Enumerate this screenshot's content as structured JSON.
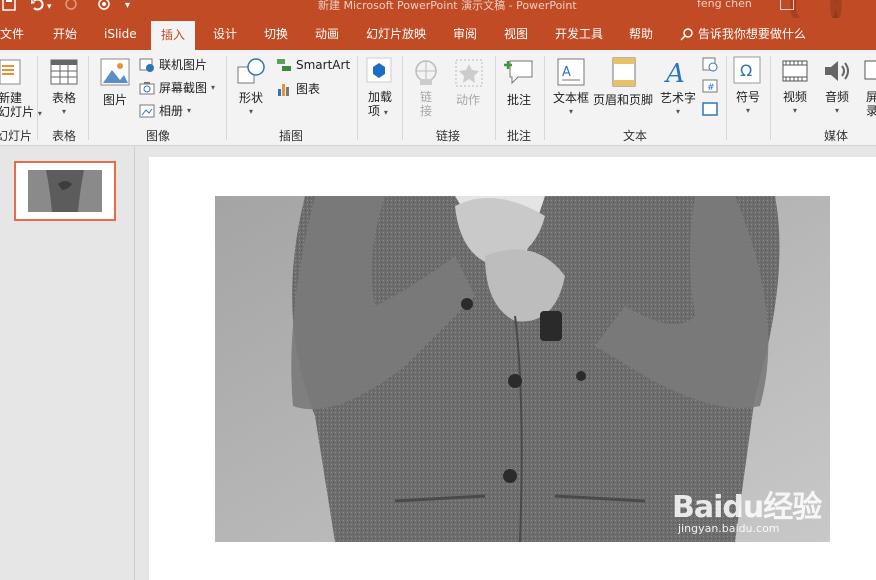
{
  "app": {
    "title": "新建 Microsoft PowerPoint 演示文稿  -  PowerPoint",
    "user": "feng chen",
    "colors": {
      "accent": "#c04b24",
      "ribbon_bg": "#f3f3f3",
      "thumb_border": "#e46c47"
    }
  },
  "qat": {
    "save_icon": "save-icon",
    "undo_icon": "undo-icon",
    "redo_icon": "redo-icon",
    "present_icon": "present-icon",
    "more_icon": "customize-icon"
  },
  "tabs": [
    {
      "label": "文件"
    },
    {
      "label": "开始"
    },
    {
      "label": "iSlide"
    },
    {
      "label": "插入"
    },
    {
      "label": "设计"
    },
    {
      "label": "切换"
    },
    {
      "label": "动画"
    },
    {
      "label": "幻灯片放映"
    },
    {
      "label": "审阅"
    },
    {
      "label": "视图"
    },
    {
      "label": "开发工具"
    },
    {
      "label": "帮助"
    }
  ],
  "active_tab": "插入",
  "tell_me": "告诉我你想要做什么",
  "ribbon": {
    "groups": {
      "slides": {
        "label": "幻灯片",
        "new_slide_line1": "新建",
        "new_slide_line2": "幻灯片"
      },
      "tables": {
        "label": "表格",
        "table": "表格"
      },
      "images": {
        "label": "图像",
        "picture": "图片",
        "online_picture": "联机图片",
        "screenshot": "屏幕截图",
        "album": "相册"
      },
      "illustrations": {
        "label": "插图",
        "shapes": "形状",
        "smartart": "SmartArt",
        "chart": "图表"
      },
      "addins": {
        "label": "",
        "addins_line1": "加载",
        "addins_line2": "项"
      },
      "links": {
        "label": "链接",
        "link_line1": "链",
        "link_line2": "接",
        "action": "动作"
      },
      "comments": {
        "label": "批注",
        "comment": "批注"
      },
      "text": {
        "label": "文本",
        "textbox": "文本框",
        "header_footer": "页眉和页脚",
        "wordart": "艺术字"
      },
      "symbols": {
        "label": "",
        "symbol": "符号"
      },
      "media": {
        "label": "媒体",
        "video": "视频",
        "audio": "音频",
        "screen_rec_line1": "屏",
        "screen_rec_line2": "录"
      }
    }
  },
  "slides_pane": {
    "selected_index": 1,
    "count": 1
  },
  "watermark": {
    "brand": "Baidu经验",
    "url": "jingyan.baidu.com"
  }
}
